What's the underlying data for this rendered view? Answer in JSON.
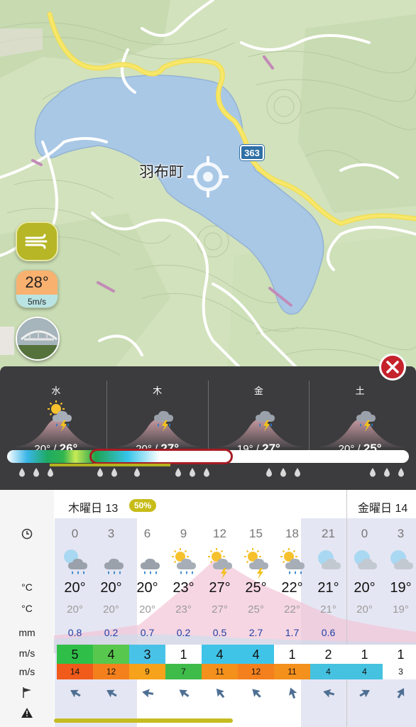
{
  "map": {
    "place_name": "羽布町",
    "route_number": "363",
    "temperature_button": "28°",
    "wind_button": "5m/s",
    "icons": [
      "wind-icon",
      "crosshair-icon",
      "webcam-thumbnail"
    ]
  },
  "panel": {
    "days": [
      {
        "name": "水",
        "low": "20° /",
        "high": "26°",
        "icon": "sun-cloud-rain-thunder"
      },
      {
        "name": "木",
        "low": "20° /",
        "high": "27°",
        "icon": "cloud-rain-thunder"
      },
      {
        "name": "金",
        "low": "19° /",
        "high": "27°",
        "icon": "cloud-rain-thunder"
      },
      {
        "name": "土",
        "low": "20° /",
        "high": "25°",
        "icon": "cloud-rain-thunder"
      }
    ]
  },
  "table": {
    "row_labels": {
      "temp": "°C",
      "feels": "°C",
      "precip": "mm",
      "wind": "m/s",
      "gust": "m/s"
    },
    "day1_header": "木曜日 13",
    "day1_probability": "50%",
    "day2_header": "金曜日 14",
    "columns": [
      {
        "hour": "0",
        "temp": "20°",
        "feels": "20°",
        "mm": "0.8",
        "wind": "5",
        "gust": "14",
        "icon": "cloud-rain-moon",
        "wc": "#2fbf48",
        "gc": "#f05a1a"
      },
      {
        "hour": "3",
        "temp": "20°",
        "feels": "20°",
        "mm": "0.2",
        "wind": "4",
        "gust": "12",
        "icon": "cloud-rain",
        "wc": "#57c84d",
        "gc": "#f4801d"
      },
      {
        "hour": "6",
        "temp": "20°",
        "feels": "20°",
        "mm": "0.7",
        "wind": "3",
        "gust": "9",
        "icon": "cloud-rain",
        "wc": "#49c2e8",
        "gc": "#f6a21b"
      },
      {
        "hour": "9",
        "temp": "23°",
        "feels": "23°",
        "mm": "0.2",
        "wind": "1",
        "gust": "7",
        "icon": "sun-cloud-rain",
        "wc": "#ffffff",
        "gc": "#3fbb4a"
      },
      {
        "hour": "12",
        "temp": "27°",
        "feels": "27°",
        "mm": "0.5",
        "wind": "4",
        "gust": "11",
        "icon": "sun-cloud-thunder",
        "wc": "#3fc4e8",
        "gc": "#f4901c"
      },
      {
        "hour": "15",
        "temp": "25°",
        "feels": "25°",
        "mm": "2.7",
        "wind": "4",
        "gust": "12",
        "icon": "sun-cloud-thunder",
        "wc": "#3fc4e8",
        "gc": "#f4801d"
      },
      {
        "hour": "18",
        "temp": "22°",
        "feels": "22°",
        "mm": "1.7",
        "wind": "1",
        "gust": "11",
        "icon": "sun-cloud-rain",
        "wc": "#ffffff",
        "gc": "#f4901c"
      },
      {
        "hour": "21",
        "temp": "21°",
        "feels": "21°",
        "mm": "0.6",
        "wind": "2",
        "gust": "4",
        "icon": "moon-cloud",
        "wc": "#ffffff",
        "gc": "#45c2e0"
      },
      {
        "hour": "0",
        "temp": "20°",
        "feels": "20°",
        "mm": "",
        "wind": "1",
        "gust": "4",
        "icon": "moon-cloud",
        "wc": "#ffffff",
        "gc": "#45c2e0"
      },
      {
        "hour": "3",
        "temp": "19°",
        "feels": "19°",
        "mm": "",
        "wind": "1",
        "gust": "3",
        "icon": "moon-cloud",
        "wc": "#ffffff",
        "gc": "#ffffff"
      }
    ],
    "wind_dirs_deg": [
      -60,
      -60,
      -80,
      -55,
      -40,
      -45,
      -20,
      -75,
      60,
      30
    ]
  },
  "colors": {
    "accent_red": "#c5222c",
    "probability_badge": "#c7bc18",
    "route_yellow": "#f4e15c",
    "water": "#a9c8e6"
  }
}
